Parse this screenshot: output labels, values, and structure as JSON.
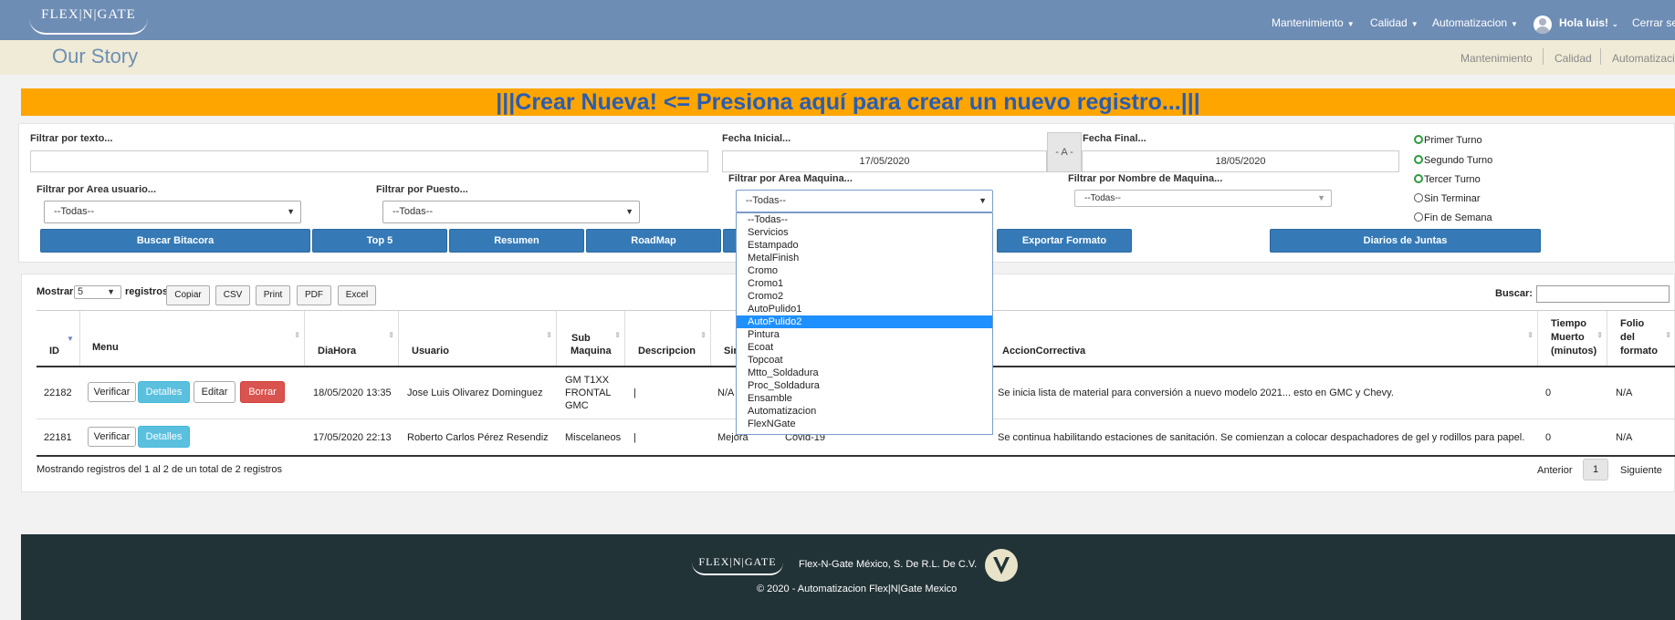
{
  "brand": {
    "logo_text": "FLEX|N|GATE"
  },
  "topnav": {
    "menu": [
      {
        "label": "Mantenimiento"
      },
      {
        "label": "Calidad"
      },
      {
        "label": "Automatizacion"
      }
    ],
    "greeting": "Hola luis!",
    "logout": "Cerrar ses"
  },
  "subheader": {
    "title": "Our Story",
    "breadcrumbs": [
      "Mantenimiento",
      "Calidad",
      "Automatizacio"
    ]
  },
  "banner": {
    "text": "|||Crear Nueva! <= Presiona aquí para crear un nuevo registro...|||"
  },
  "filters": {
    "text_label": "Filtrar por texto...",
    "text_value": "",
    "fecha_inicial_label": "Fecha Inicial...",
    "fecha_inicial_value": "17/05/2020",
    "range_sep": "- A -",
    "fecha_final_label": "Fecha Final...",
    "fecha_final_value": "18/05/2020",
    "area_usuario_label": "Filtrar por Area usuario...",
    "area_usuario_value": "--Todas--",
    "puesto_label": "Filtrar por Puesto...",
    "puesto_value": "--Todas--",
    "area_maquina_label": "Filtrar por Area Maquina...",
    "area_maquina_value": "--Todas--",
    "nombre_maquina_label": "Filtrar por Nombre de Maquina...",
    "nombre_maquina_value": "--Todas--",
    "turnos": [
      {
        "label": "Primer Turno",
        "checked": true
      },
      {
        "label": "Segundo Turno",
        "checked": true
      },
      {
        "label": "Tercer Turno",
        "checked": true
      },
      {
        "label": "Sin Terminar",
        "checked": false
      },
      {
        "label": "Fin de Semana",
        "checked": false
      }
    ]
  },
  "actions": {
    "buscar": "Buscar Bitacora",
    "top5": "Top 5",
    "resumen": "Resumen",
    "roadmap": "RoadMap",
    "exportar": "Exportar Formato",
    "diarios": "Diarios de Juntas"
  },
  "area_dropdown": {
    "options": [
      "--Todas--",
      "Servicios",
      "Estampado",
      "MetalFinish",
      "Cromo",
      "Cromo1",
      "Cromo2",
      "AutoPulido1",
      "AutoPulido2",
      "Pintura",
      "Ecoat",
      "Topcoat",
      "Mtto_Soldadura",
      "Proc_Soldadura",
      "Ensamble",
      "Automatizacion",
      "FlexNGate"
    ],
    "highlighted": "AutoPulido2"
  },
  "table": {
    "show_prefix": "Mostrar",
    "show_value": "5",
    "show_suffix": "registros",
    "export_buttons": [
      "Copiar",
      "CSV",
      "Print",
      "PDF",
      "Excel"
    ],
    "search_label": "Buscar:",
    "search_value": "",
    "headers": {
      "id": "ID",
      "menu": "Menu",
      "diahora": "DiaHora",
      "usuario": "Usuario",
      "submaquina_1": "Sub",
      "submaquina_2": "Maquina",
      "descripcion": "Descripcion",
      "sin": "Sin",
      "accion": "AccionCorrectiva",
      "tiempo_1": "Tiempo",
      "tiempo_2": "Muerto",
      "tiempo_3": "(minutos)",
      "folio_1": "Folio",
      "folio_2": "del",
      "folio_3": "formato"
    },
    "row_buttons": {
      "verificar": "Verificar",
      "detalles": "Detalles",
      "editar": "Editar",
      "borrar": "Borrar"
    },
    "rows": [
      {
        "id": "22182",
        "diahora": "18/05/2020 13:35",
        "usuario": "Jose Luis Olivarez Dominguez",
        "submaquina_1": "GM T1XX",
        "submaquina_2": "FRONTAL",
        "submaquina_3": "GMC",
        "descripcion": "|",
        "sin": "N/A",
        "extra": "",
        "accion": "Se inicia lista de material para conversión a nuevo modelo 2021... esto en GMC y Chevy.",
        "tiempo": "0",
        "folio": "N/A"
      },
      {
        "id": "22181",
        "diahora": "17/05/2020 22:13",
        "usuario": "Roberto Carlos Pérez Resendiz",
        "submaquina_1": "Miscelaneos",
        "descripcion": "|",
        "sin": "Mejora",
        "extra": "Covid-19",
        "accion": "Se continua habilitando estaciones de sanitación. Se comienzan a colocar despachadores de gel y rodillos para papel.",
        "tiempo": "0",
        "folio": "N/A"
      }
    ],
    "info": "Mostrando registros del 1 al 2 de un total de 2 registros",
    "pagination": {
      "prev": "Anterior",
      "page": "1",
      "next": "Siguiente"
    }
  },
  "footer": {
    "logo_text": "FLEX|N|GATE",
    "company": "Flex-N-Gate México, S. De R.L. De C.V.",
    "copyright": "© 2020 - Automatizacion Flex|N|Gate Mexico"
  }
}
